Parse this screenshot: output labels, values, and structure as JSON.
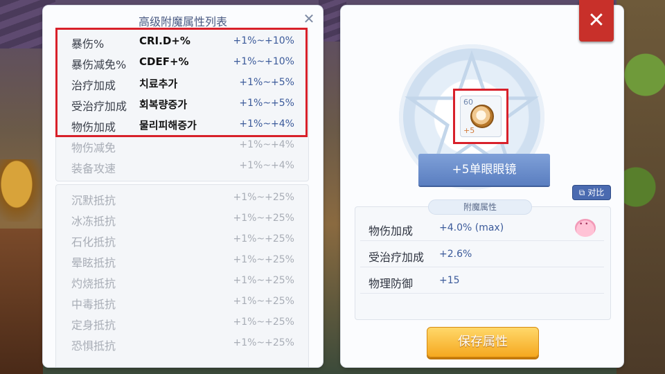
{
  "left_panel": {
    "title": "高级附魔属性列表",
    "close_icon": "✕",
    "top_rows": [
      {
        "name": "暴伤%",
        "kr": "CRI.D+%",
        "range": "+1%~+10%"
      },
      {
        "name": "暴伤减免%",
        "kr": "CDEF+%",
        "range": "+1%~+10%"
      },
      {
        "name": "治疗加成",
        "kr": "치료추가",
        "range": "+1%~+5%"
      },
      {
        "name": "受治疗加成",
        "kr": "회복량증가",
        "range": "+1%~+5%"
      },
      {
        "name": "物伤加成",
        "kr": "물리피해증가",
        "range": "+1%~+4%"
      },
      {
        "name": "物伤减免",
        "kr": "",
        "range": "+1%~+4%"
      },
      {
        "name": "装备攻速",
        "kr": "",
        "range": "+1%~+4%"
      }
    ],
    "bottom_rows": [
      {
        "name": "沉默抵抗",
        "range": "+1%~+25%"
      },
      {
        "name": "冰冻抵抗",
        "range": "+1%~+25%"
      },
      {
        "name": "石化抵抗",
        "range": "+1%~+25%"
      },
      {
        "name": "晕眩抵抗",
        "range": "+1%~+25%"
      },
      {
        "name": "灼烧抵抗",
        "range": "+1%~+25%"
      },
      {
        "name": "中毒抵抗",
        "range": "+1%~+25%"
      },
      {
        "name": "定身抵抗",
        "range": "+1%~+25%"
      },
      {
        "name": "恐惧抵抗",
        "range": "+1%~+25%"
      }
    ]
  },
  "right_panel": {
    "item": {
      "level": "60",
      "refine": "+5",
      "name": "+5单眼眼镜",
      "icon": "monocle-icon"
    },
    "compare_label": "对比",
    "compare_icon": "compare-icon",
    "attr_tab": "附魔属性",
    "attributes": [
      {
        "name": "物伤加成",
        "value": "+4.0%  (max)"
      },
      {
        "name": "受治疗加成",
        "value": "+2.6%"
      },
      {
        "name": "物理防御",
        "value": "+15"
      }
    ],
    "save_label": "保存属性",
    "close_icon": "✕"
  },
  "colors": {
    "highlight": "#d8202a",
    "accent_blue": "#3b5a9a",
    "save_orange": "#f5a820",
    "close_red": "#c8302a"
  }
}
